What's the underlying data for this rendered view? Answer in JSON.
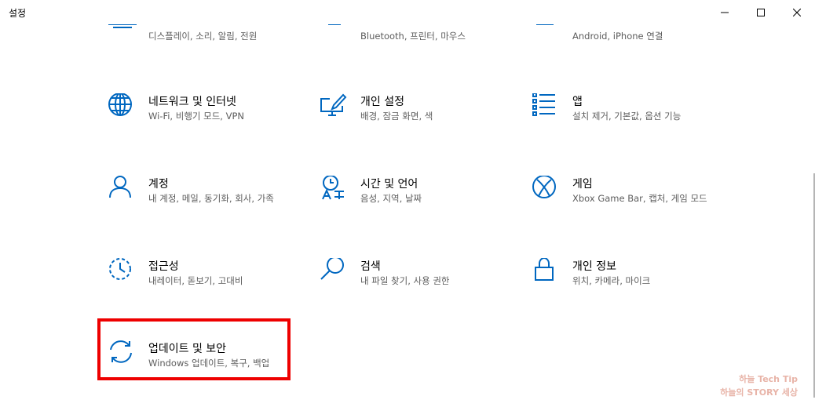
{
  "window": {
    "title": "설정",
    "controls": [
      "minimize-icon",
      "maximize-icon",
      "close-icon"
    ]
  },
  "categories": [
    {
      "id": "system",
      "icon": "monitor-icon",
      "name": "",
      "desc": "디스플레이, 소리, 알림, 전원"
    },
    {
      "id": "devices",
      "icon": "keyboard-icon",
      "name": "",
      "desc": "Bluetooth, 프린터, 마우스"
    },
    {
      "id": "phone",
      "icon": "phone-icon",
      "name": "",
      "desc": "Android, iPhone 연결"
    },
    {
      "id": "network",
      "icon": "globe-icon",
      "name": "네트워크 및 인터넷",
      "desc": "Wi-Fi, 비행기 모드, VPN"
    },
    {
      "id": "personalization",
      "icon": "paint-brush-monitor-icon",
      "name": "개인 설정",
      "desc": "배경, 잠금 화면, 색"
    },
    {
      "id": "apps",
      "icon": "app-list-icon",
      "name": "앱",
      "desc": "설치 제거, 기본값, 옵션 기능"
    },
    {
      "id": "accounts",
      "icon": "person-icon",
      "name": "계정",
      "desc": "내 계정, 메일, 동기화, 회사, 가족"
    },
    {
      "id": "time",
      "icon": "clock-language-icon",
      "name": "시간 및 언어",
      "desc": "음성, 지역, 날짜"
    },
    {
      "id": "gaming",
      "icon": "xbox-icon",
      "name": "게임",
      "desc": "Xbox Game Bar, 캡처, 게임 모드"
    },
    {
      "id": "ease",
      "icon": "ease-of-access-icon",
      "name": "접근성",
      "desc": "내레이터, 돋보기, 고대비"
    },
    {
      "id": "search",
      "icon": "search-icon",
      "name": "검색",
      "desc": "내 파일 찾기, 사용 권한"
    },
    {
      "id": "privacy",
      "icon": "lock-icon",
      "name": "개인 정보",
      "desc": "위치, 카메라, 마이크"
    },
    {
      "id": "update",
      "icon": "sync-arrows-icon",
      "name": "업데이트 및 보안",
      "desc": "Windows 업데이트, 복구, 백업"
    }
  ],
  "watermark": {
    "line1": "하늘 Tech Tip",
    "line2": "하늘의 STORY 세상"
  },
  "colors": {
    "accent": "#0067c0",
    "highlight": "#ee0000",
    "description": "#5d5d5d"
  }
}
